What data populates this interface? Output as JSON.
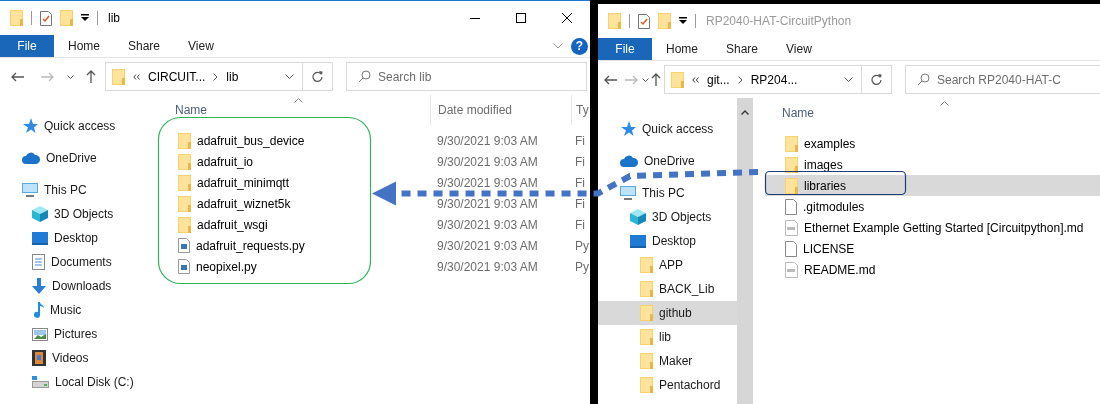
{
  "windows": [
    {
      "title": "lib",
      "active": true,
      "window_buttons": true,
      "help": "?",
      "sidebar_scrollbar": false,
      "ribbon_tabs": [
        {
          "label": "File",
          "selected": true
        },
        {
          "label": "Home",
          "selected": false
        },
        {
          "label": "Share",
          "selected": false
        },
        {
          "label": "View",
          "selected": false
        }
      ],
      "address": [
        "CIRCUIT...",
        "lib"
      ],
      "search": {
        "placeholder": "Search lib"
      },
      "sidebar": [
        {
          "label": "Quick access",
          "kind": "star",
          "selected": false
        },
        {
          "label": "OneDrive",
          "kind": "cloud",
          "selected": false
        },
        {
          "label": "This PC",
          "kind": "pc",
          "selected": false,
          "children": [
            {
              "label": "3D Objects",
              "kind": "cube",
              "selected": false
            },
            {
              "label": "Desktop",
              "kind": "desktop",
              "selected": false
            },
            {
              "label": "Documents",
              "kind": "documents",
              "selected": false
            },
            {
              "label": "Downloads",
              "kind": "downloads",
              "selected": false
            },
            {
              "label": "Music",
              "kind": "music",
              "selected": false
            },
            {
              "label": "Pictures",
              "kind": "pictures",
              "selected": false
            },
            {
              "label": "Videos",
              "kind": "videos",
              "selected": false
            },
            {
              "label": "Local Disk (C:)",
              "kind": "disk",
              "selected": false
            }
          ]
        }
      ],
      "columns": [
        "Name",
        "Date modified",
        "Ty"
      ],
      "files": [
        {
          "name": "adafruit_bus_device",
          "kind": "folder",
          "date": "9/30/2021 9:03 AM",
          "type": "Fi",
          "selected": false
        },
        {
          "name": "adafruit_io",
          "kind": "folder",
          "date": "9/30/2021 9:03 AM",
          "type": "Fi",
          "selected": false
        },
        {
          "name": "adafruit_minimqtt",
          "kind": "folder",
          "date": "9/30/2021 9:03 AM",
          "type": "Fi",
          "selected": false
        },
        {
          "name": "adafruit_wiznet5k",
          "kind": "folder",
          "date": "9/30/2021 9:03 AM",
          "type": "Fi",
          "selected": false
        },
        {
          "name": "adafruit_wsgi",
          "kind": "folder",
          "date": "9/30/2021 9:03 AM",
          "type": "Fi",
          "selected": false
        },
        {
          "name": "adafruit_requests.py",
          "kind": "py",
          "date": "9/30/2021 9:03 AM",
          "type": "Py",
          "selected": false
        },
        {
          "name": "neopixel.py",
          "kind": "py",
          "date": "9/30/2021 9:03 AM",
          "type": "Py",
          "selected": false
        }
      ]
    },
    {
      "title": "RP2040-HAT-CircuitPython",
      "active": false,
      "window_buttons": false,
      "sidebar_scrollbar": true,
      "ribbon_tabs": [
        {
          "label": "File",
          "selected": true
        },
        {
          "label": "Home",
          "selected": false
        },
        {
          "label": "Share",
          "selected": false
        },
        {
          "label": "View",
          "selected": false
        }
      ],
      "address": [
        "git...",
        "RP204..."
      ],
      "search": {
        "placeholder": "Search RP2040-HAT-C"
      },
      "sidebar": [
        {
          "label": "Quick access",
          "kind": "star",
          "selected": false
        },
        {
          "label": "OneDrive",
          "kind": "cloud",
          "selected": false
        },
        {
          "label": "This PC",
          "kind": "pc",
          "selected": false,
          "children": [
            {
              "label": "3D Objects",
              "kind": "cube",
              "selected": false
            },
            {
              "label": "Desktop",
              "kind": "desktop",
              "selected": false,
              "children": [
                {
                  "label": "APP",
                  "kind": "folder",
                  "selected": false
                },
                {
                  "label": "BACK_Lib",
                  "kind": "folder",
                  "selected": false
                },
                {
                  "label": "github",
                  "kind": "folder",
                  "selected": true
                },
                {
                  "label": "lib",
                  "kind": "folder",
                  "selected": false
                },
                {
                  "label": "Maker",
                  "kind": "folder",
                  "selected": false
                },
                {
                  "label": "Pentachord",
                  "kind": "folder",
                  "selected": false
                }
              ]
            }
          ]
        }
      ],
      "columns": [
        "Name"
      ],
      "files": [
        {
          "name": "examples",
          "kind": "folder",
          "selected": false
        },
        {
          "name": "images",
          "kind": "folder",
          "selected": false
        },
        {
          "name": "libraries",
          "kind": "folder",
          "selected": true
        },
        {
          "name": ".gitmodules",
          "kind": "file",
          "selected": false
        },
        {
          "name": "Ethernet Example Getting Started [Circuitpython].md",
          "kind": "md",
          "selected": false
        },
        {
          "name": "LICENSE",
          "kind": "file",
          "selected": false
        },
        {
          "name": "README.md",
          "kind": "md",
          "selected": false
        }
      ]
    }
  ]
}
